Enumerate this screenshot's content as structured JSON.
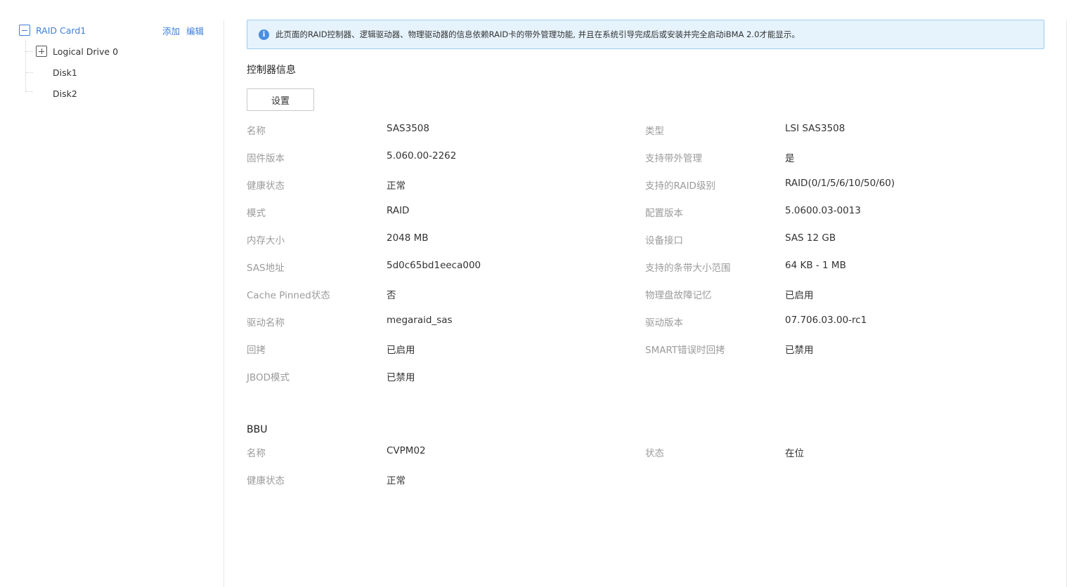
{
  "tree": {
    "root": {
      "label": "RAID Card1"
    },
    "actions": {
      "add": "添加",
      "edit": "编辑"
    },
    "children": [
      {
        "label": "Logical Drive 0"
      },
      {
        "label": "Disk1"
      },
      {
        "label": "Disk2"
      }
    ]
  },
  "banner": {
    "text": "此页面的RAID控制器、逻辑驱动器、物理驱动器的信息依赖RAID卡的带外管理功能, 并且在系统引导完成后或安装并完全启动iBMA 2.0才能显示。"
  },
  "controller": {
    "title": "控制器信息",
    "settings_label": "设置",
    "rows": [
      {
        "l1": "名称",
        "v1": "SAS3508",
        "l2": "类型",
        "v2": "LSI SAS3508"
      },
      {
        "l1": "固件版本",
        "v1": "5.060.00-2262",
        "l2": "支持带外管理",
        "v2": "是"
      },
      {
        "l1": "健康状态",
        "v1": "正常",
        "l2": "支持的RAID级别",
        "v2": "RAID(0/1/5/6/10/50/60)"
      },
      {
        "l1": "模式",
        "v1": "RAID",
        "l2": "配置版本",
        "v2": "5.0600.03-0013"
      },
      {
        "l1": "内存大小",
        "v1": "2048 MB",
        "l2": "设备接口",
        "v2": "SAS 12 GB"
      },
      {
        "l1": "SAS地址",
        "v1": "5d0c65bd1eeca000",
        "l2": "支持的条带大小范围",
        "v2": "64 KB - 1 MB"
      },
      {
        "l1": "Cache Pinned状态",
        "v1": "否",
        "l2": "物理盘故障记忆",
        "v2": "已启用"
      },
      {
        "l1": "驱动名称",
        "v1": "megaraid_sas",
        "l2": "驱动版本",
        "v2": "07.706.03.00-rc1"
      },
      {
        "l1": "回拷",
        "v1": "已启用",
        "l2": "SMART错误时回拷",
        "v2": "已禁用"
      },
      {
        "l1": "JBOD模式",
        "v1": "已禁用",
        "l2": "",
        "v2": ""
      }
    ]
  },
  "bbu": {
    "title": "BBU",
    "rows": [
      {
        "l1": "名称",
        "v1": "CVPM02",
        "l2": "状态",
        "v2": "在位"
      },
      {
        "l1": "健康状态",
        "v1": "正常",
        "l2": "",
        "v2": ""
      }
    ]
  }
}
